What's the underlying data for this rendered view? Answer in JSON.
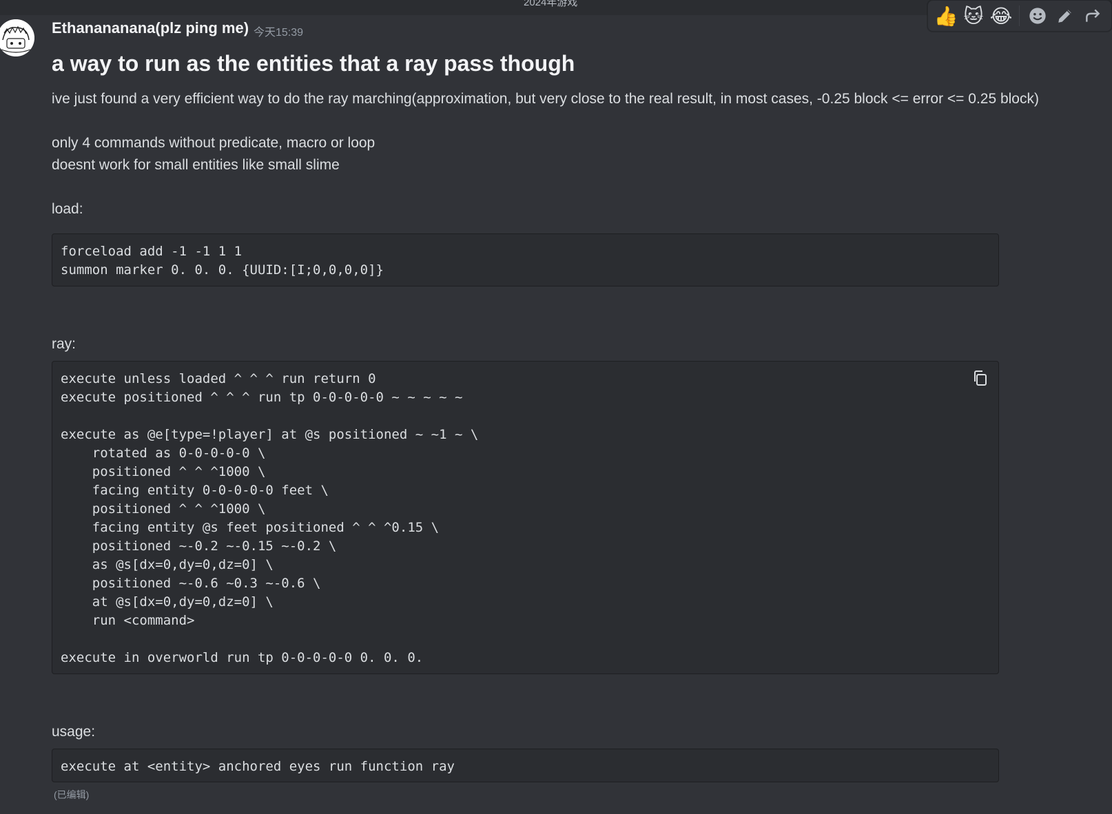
{
  "header": {
    "channel_title": "2024年游戏"
  },
  "message": {
    "author": "Ethanananana(plz ping me)",
    "timestamp": "今天15:39",
    "title": "a way to run as the entities that a ray pass though",
    "intro_lines": [
      "ive just found a very efficient way to do the ray marching(approximation, but very close to the real result, in most cases, -0.25 block <= error <= 0.25 block)",
      "only 4 commands without predicate, macro or loop",
      "doesnt work for small entities like small slime"
    ],
    "sections": {
      "load_label": "load:",
      "load_code": "forceload add -1 -1 1 1\nsummon marker 0. 0. 0. {UUID:[I;0,0,0,0]}",
      "ray_label": "ray:",
      "ray_code": "execute unless loaded ^ ^ ^ run return 0\nexecute positioned ^ ^ ^ run tp 0-0-0-0-0 ~ ~ ~ ~ ~\n\nexecute as @e[type=!player] at @s positioned ~ ~1 ~ \\\n    rotated as 0-0-0-0-0 \\\n    positioned ^ ^ ^1000 \\\n    facing entity 0-0-0-0-0 feet \\\n    positioned ^ ^ ^1000 \\\n    facing entity @s feet positioned ^ ^ ^0.15 \\\n    positioned ~-0.2 ~-0.15 ~-0.2 \\\n    as @s[dx=0,dy=0,dz=0] \\\n    positioned ~-0.6 ~0.3 ~-0.6 \\\n    at @s[dx=0,dy=0,dz=0] \\\n    run <command>\n\nexecute in overworld run tp 0-0-0-0-0 0. 0. 0.",
      "usage_label": "usage:",
      "usage_code": "execute at <entity> anchored eyes run function ray"
    },
    "edited_label": "(已编辑)"
  },
  "toolbar": {
    "reactions": [
      {
        "emoji": "👍",
        "icon": "thumbs-up-icon"
      },
      {
        "emoji": "🐱",
        "icon": "custom-cat-emoji-icon"
      },
      {
        "emoji": "😂",
        "icon": "joy-icon"
      }
    ],
    "actions": [
      "add-reaction-icon",
      "edit-icon",
      "reply-icon"
    ]
  },
  "colors": {
    "background": "#313338",
    "code_background": "#2b2d31",
    "text": "#dbdee1",
    "muted": "#949ba4"
  }
}
